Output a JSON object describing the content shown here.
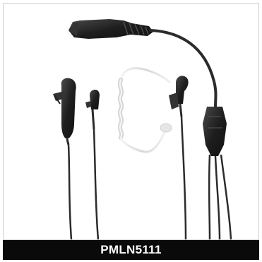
{
  "product": {
    "model_label": "PMLN5111"
  },
  "colors": {
    "caption_background": "#0a0a0a",
    "caption_text": "#ffffff",
    "frame_border": "#cfcfcf",
    "cable": "#2b2b2b",
    "acoustic_tube": "#e4e4e4"
  }
}
